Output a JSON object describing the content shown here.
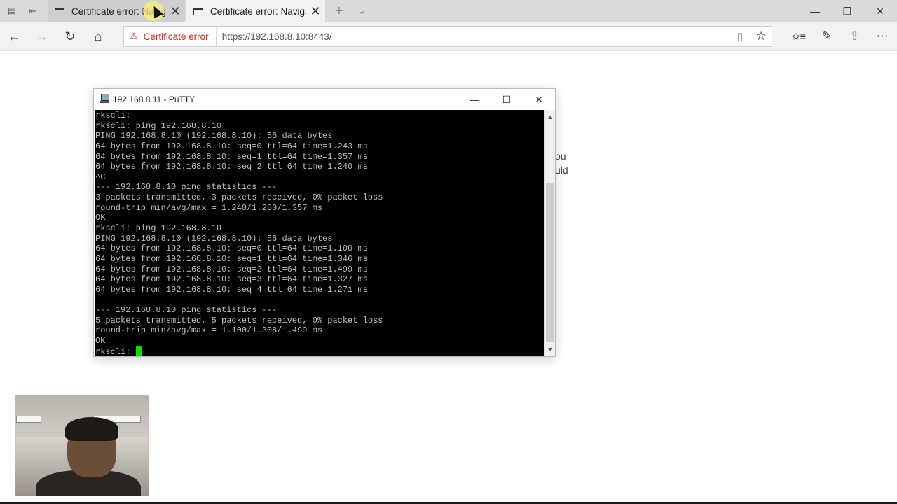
{
  "browser": {
    "tabs": [
      {
        "label": "Certificate error: Naviga",
        "state": "inactive"
      },
      {
        "label": "Certificate error: Naviga",
        "state": "active"
      }
    ],
    "address": {
      "security_label": "Certificate error",
      "url": "https://192.168.8.10:8443/"
    },
    "icons": {
      "back": "←",
      "forward": "→",
      "refresh": "↻",
      "home": "⌂",
      "reading_view": "▯",
      "favorite": "☆",
      "favorites_hub": "✩≡",
      "notes": "✎",
      "share": "⇪",
      "more": "⋯",
      "new_tab": "+",
      "tab_list": "⌄",
      "tab_close": "✕",
      "minimize": "—",
      "restore": "❐",
      "close_window": "✕"
    }
  },
  "background_page": {
    "fragment_1": "ou",
    "fragment_2": "uld"
  },
  "putty": {
    "title": "192.168.8.11 - PuTTY",
    "terminal_lines": [
      "rkscli:",
      "rkscli: ping 192.168.8.10",
      "PING 192.168.8.10 (192.168.8.10): 56 data bytes",
      "64 bytes from 192.168.8.10: seq=0 ttl=64 time=1.243 ms",
      "64 bytes from 192.168.8.10: seq=1 ttl=64 time=1.357 ms",
      "64 bytes from 192.168.8.10: seq=2 ttl=64 time=1.240 ms",
      "^C",
      "--- 192.168.8.10 ping statistics ---",
      "3 packets transmitted, 3 packets received, 0% packet loss",
      "round-trip min/avg/max = 1.240/1.280/1.357 ms",
      "OK",
      "rkscli: ping 192.168.8.10",
      "PING 192.168.8.10 (192.168.8.10): 56 data bytes",
      "64 bytes from 192.168.8.10: seq=0 ttl=64 time=1.100 ms",
      "64 bytes from 192.168.8.10: seq=1 ttl=64 time=1.346 ms",
      "64 bytes from 192.168.8.10: seq=2 ttl=64 time=1.499 ms",
      "64 bytes from 192.168.8.10: seq=3 ttl=64 time=1.327 ms",
      "64 bytes from 192.168.8.10: seq=4 ttl=64 time=1.271 ms",
      "",
      "--- 192.168.8.10 ping statistics ---",
      "5 packets transmitted, 5 packets received, 0% packet loss",
      "round-trip min/avg/max = 1.100/1.308/1.499 ms",
      "OK"
    ],
    "prompt": "rkscli: ",
    "colors": {
      "terminal_bg": "#000000",
      "terminal_fg": "#bfbfbf",
      "cursor": "#00dd00"
    }
  },
  "colors": {
    "cert_error": "#c42b1c",
    "tabstrip": "#dadada",
    "toolbar": "#f2f2f2"
  }
}
